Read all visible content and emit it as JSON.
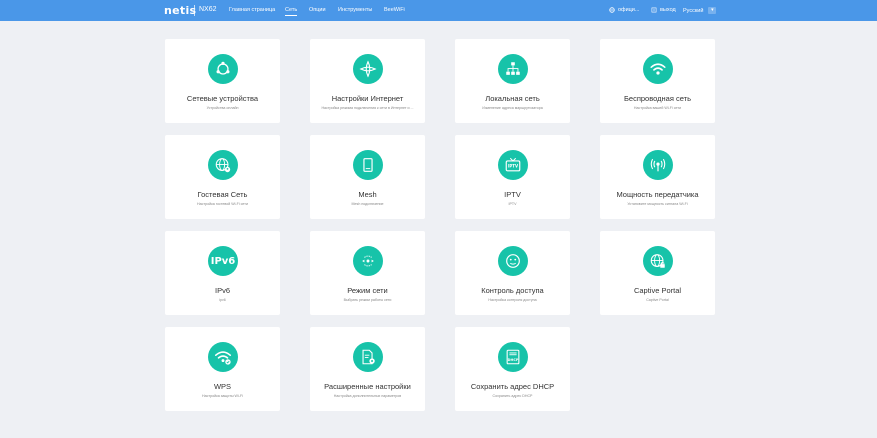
{
  "header": {
    "brand": "netis",
    "model": "NX62",
    "nav": [
      {
        "label": "Главная страница",
        "active": false
      },
      {
        "label": "Сеть",
        "active": true
      },
      {
        "label": "Опции",
        "active": false
      },
      {
        "label": "Инструменты",
        "active": false
      },
      {
        "label": "BeeWiFi",
        "active": false
      }
    ],
    "official_label": "офици...",
    "logout_label": "выход",
    "language": "Русский"
  },
  "cards": [
    {
      "title": "Сетевые устройства",
      "subtitle": "Устройства онлайн",
      "icon": "network-devices-icon"
    },
    {
      "title": "Настройки Интернет",
      "subtitle": "Настройка режима подключения к сети в Интернет и ...",
      "icon": "internet-settings-icon"
    },
    {
      "title": "Локальная сеть",
      "subtitle": "Изменение адреса маршрутизатора",
      "icon": "lan-icon"
    },
    {
      "title": "Беспроводная сеть",
      "subtitle": "Настройка вашей Wi-Fi сети",
      "icon": "wifi-icon"
    },
    {
      "title": "Гостевая Сеть",
      "subtitle": "Настройка гостевой Wi-Fi сети",
      "icon": "guest-network-icon"
    },
    {
      "title": "Mesh",
      "subtitle": "Mesh подключение",
      "icon": "mesh-icon"
    },
    {
      "title": "IPTV",
      "subtitle": "IPTV",
      "icon": "iptv-icon",
      "icon_text": "IPTV"
    },
    {
      "title": "Мощность передатчика",
      "subtitle": "Установите мощность сигнала Wi-Fi",
      "icon": "transmit-power-icon"
    },
    {
      "title": "IPv6",
      "subtitle": "ipv6",
      "icon": "ipv6-icon",
      "icon_text": "IPv6"
    },
    {
      "title": "Режим сети",
      "subtitle": "Выбрать режим работы сети",
      "icon": "network-mode-icon"
    },
    {
      "title": "Контроль доступа",
      "subtitle": "Настройка контроля доступа",
      "icon": "access-control-icon"
    },
    {
      "title": "Captive Portal",
      "subtitle": "Captive Portal",
      "icon": "captive-portal-icon"
    },
    {
      "title": "WPS",
      "subtitle": "Настройка защиты Wi-Fi",
      "icon": "wps-icon"
    },
    {
      "title": "Расширенные настройки",
      "subtitle": "Настройка дополнительных параметров",
      "icon": "advanced-settings-icon"
    },
    {
      "title": "Сохранить адрес DHCP",
      "subtitle": "Сохранить адрес DHCP",
      "icon": "dhcp-reservation-icon",
      "icon_text": "DHCP"
    }
  ],
  "colors": {
    "accent": "#17c3a9",
    "topbar": "#4a97e8",
    "background": "#eef0f4"
  }
}
